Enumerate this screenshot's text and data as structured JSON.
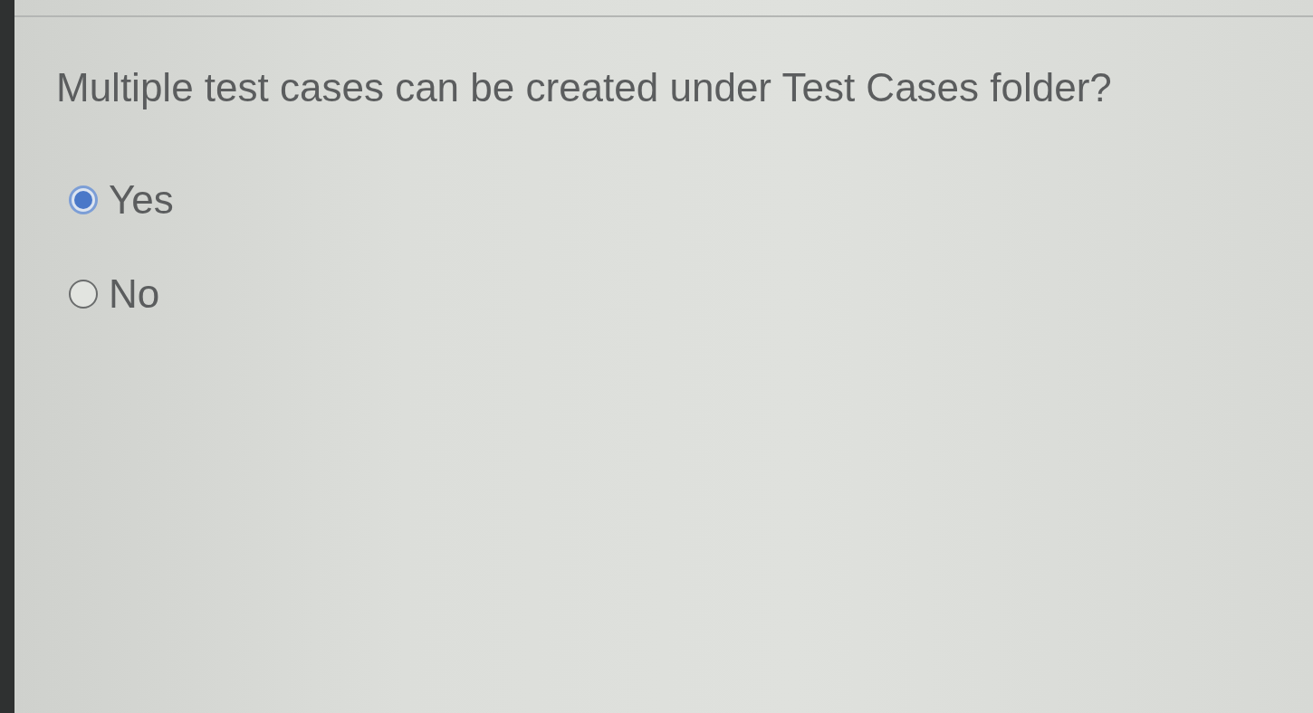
{
  "question": {
    "text": "Multiple test cases can be created under Test Cases folder?",
    "options": [
      {
        "label": "Yes",
        "selected": true
      },
      {
        "label": "No",
        "selected": false
      }
    ]
  }
}
